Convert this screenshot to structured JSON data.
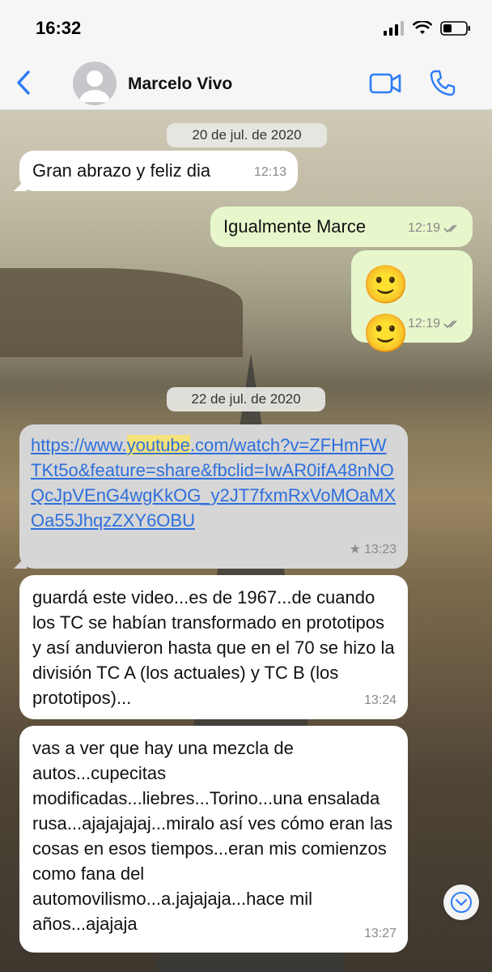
{
  "status": {
    "time": "16:32"
  },
  "header": {
    "contact_name": "Marcelo Vivo"
  },
  "chat": {
    "date1": "20 de jul. de 2020",
    "date2": "22 de jul. de 2020",
    "messages": [
      {
        "direction": "in",
        "text": "Gran abrazo y feliz dia",
        "time": "12:13"
      },
      {
        "direction": "out",
        "text": "Igualmente Marce",
        "time": "12:19"
      },
      {
        "direction": "out",
        "text": "🙂 🙂",
        "time": "12:19"
      },
      {
        "direction": "in",
        "link_prefix": "https://www.",
        "link_highlight": "youtube",
        "link_suffix": ".com/watch?v=ZFHmFWTKt5o&feature=share&fbclid=IwAR0ifA48nNOQcJpVEnG4wgKkOG_y2JT7fxmRxVoMOaMXOa55JhqzZXY6OBU",
        "time": "13:23",
        "starred": true
      },
      {
        "direction": "in",
        "text": "guardá este video...es de 1967...de cuando los TC se habían transformado en prototipos y así anduvieron hasta que en el 70 se hizo la división TC A (los actuales) y TC B (los prototipos)...",
        "time": "13:24"
      },
      {
        "direction": "in",
        "text": "vas a ver que hay una mezcla de autos...cupecitas modificadas...liebres...Torino...una ensalada rusa...ajajajajaj...miralo así ves cómo eran las cosas en esos tiempos...eran mis comienzos como fana del automovilismo...a.jajajaja...hace mil años...ajajaja",
        "time": "13:27"
      }
    ]
  },
  "icons": {
    "back": "chevron-left-icon",
    "video": "video-camera-icon",
    "call": "phone-icon",
    "scroll": "chevron-down-icon"
  },
  "colors": {
    "accent": "#2e7cf6",
    "outgoing_bubble": "#e7f7cb",
    "incoming_bubble": "#ffffff",
    "read_ticks": "#8a8a8a"
  }
}
